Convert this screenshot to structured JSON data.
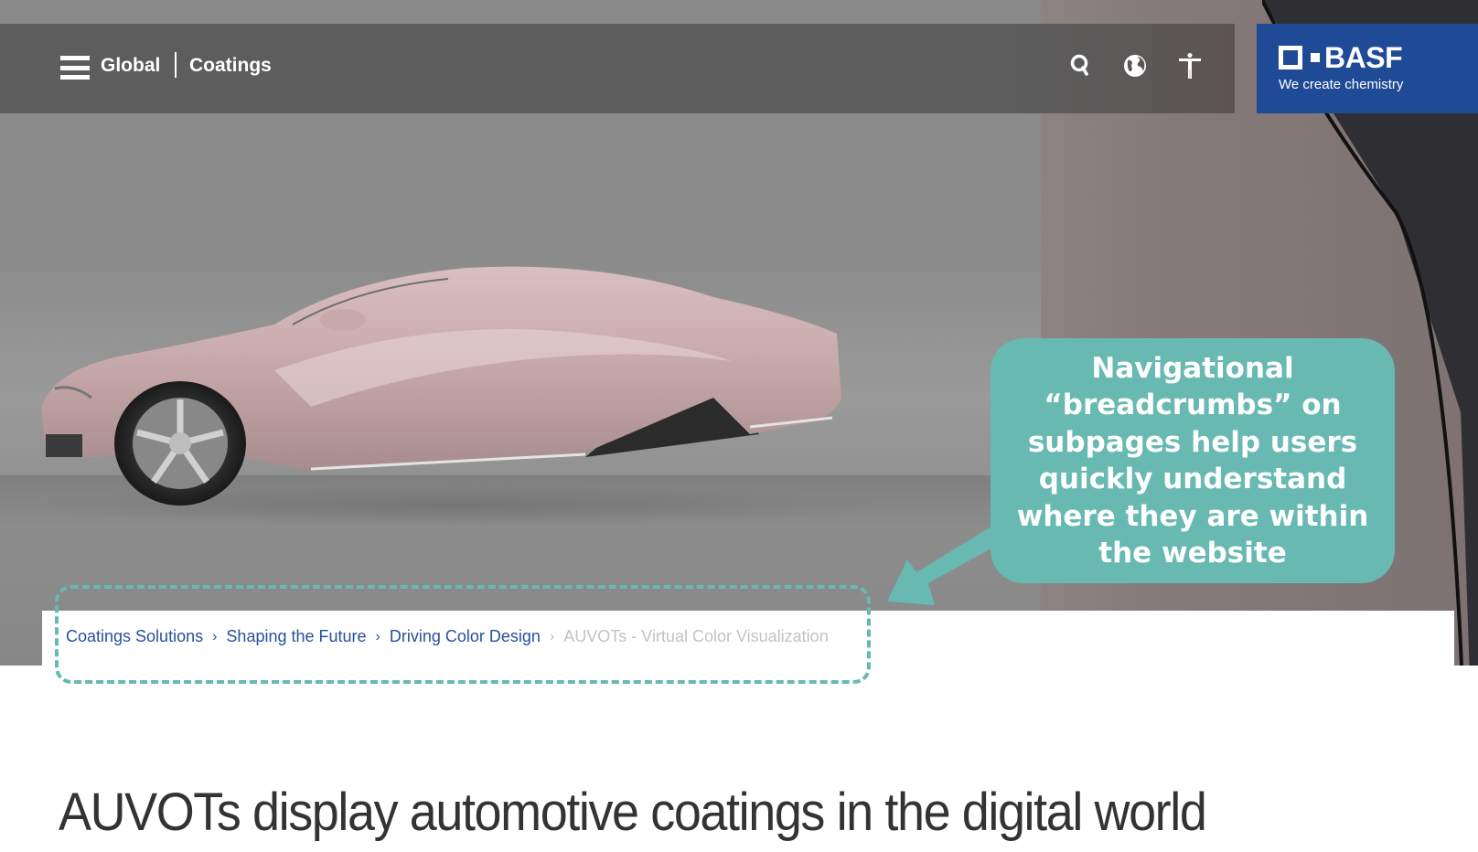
{
  "header": {
    "menu_icon": "hamburger-menu-icon",
    "nav_global": "Global",
    "nav_coatings": "Coatings",
    "icons": [
      "search-icon",
      "globe-icon",
      "accessibility-icon"
    ]
  },
  "brand": {
    "wordmark": "BASF",
    "tagline": "We create chemistry",
    "background_color": "#1f4a96"
  },
  "breadcrumb": {
    "items": [
      {
        "label": "Coatings Solutions",
        "current": false
      },
      {
        "label": "Shaping the Future",
        "current": false
      },
      {
        "label": "Driving Color Design",
        "current": false
      },
      {
        "label": "AUVOTs - Virtual Color Visualization",
        "current": true
      }
    ],
    "separator": "›",
    "link_color": "#25519b",
    "current_color": "#c3c3c3"
  },
  "annotation": {
    "text": "Navigational “breadcrumbs” on subpages help users quickly understand where they are within the website",
    "color": "#67b9b1"
  },
  "page": {
    "title": "AUVOTs display automotive coatings in the digital world"
  }
}
